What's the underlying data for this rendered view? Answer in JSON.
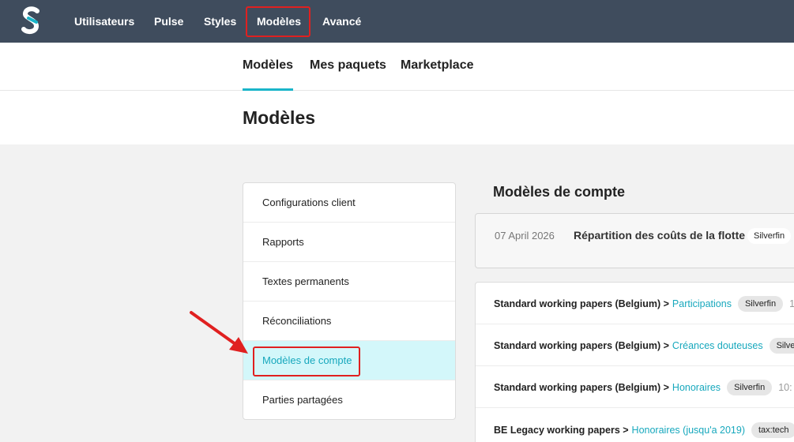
{
  "topnav": {
    "items": [
      "Utilisateurs",
      "Pulse",
      "Styles",
      "Modèles",
      "Avancé"
    ],
    "active": "Modèles"
  },
  "subnav": {
    "tabs": [
      "Modèles",
      "Mes paquets",
      "Marketplace"
    ],
    "active": "Modèles"
  },
  "page": {
    "title": "Modèles"
  },
  "sidebar": {
    "items": [
      {
        "label": "Configurations client"
      },
      {
        "label": "Rapports"
      },
      {
        "label": "Textes permanents"
      },
      {
        "label": "Réconciliations"
      },
      {
        "label": "Modèles de compte"
      },
      {
        "label": "Parties partagées"
      }
    ],
    "active": "Modèles de compte"
  },
  "content": {
    "title": "Modèles de compte",
    "featured": {
      "date": "07 April 2026",
      "title": "Répartition des coûts de la flotte",
      "badge": "Silverfin"
    },
    "rows": [
      {
        "prefix": "Standard working papers (Belgium) >",
        "link": "Participations",
        "badge": "Silverfin",
        "meta": "1"
      },
      {
        "prefix": "Standard working papers (Belgium) >",
        "link": "Créances douteuses",
        "badge": "Silverfin",
        "meta": ""
      },
      {
        "prefix": "Standard working papers (Belgium) >",
        "link": "Honoraires",
        "badge": "Silverfin",
        "meta": "10:"
      },
      {
        "prefix": "BE Legacy working papers >",
        "link": "Honoraires (jusqu'a 2019)",
        "badge": "tax:tech",
        "meta": ""
      }
    ]
  },
  "colors": {
    "topbar": "#3f4c5d",
    "accent": "#17a8bd",
    "highlight": "#e02020",
    "active_bg": "#d3f7fa"
  },
  "icons": {
    "logo": "silverfin-logo",
    "annotation": "red-arrow-icon"
  }
}
